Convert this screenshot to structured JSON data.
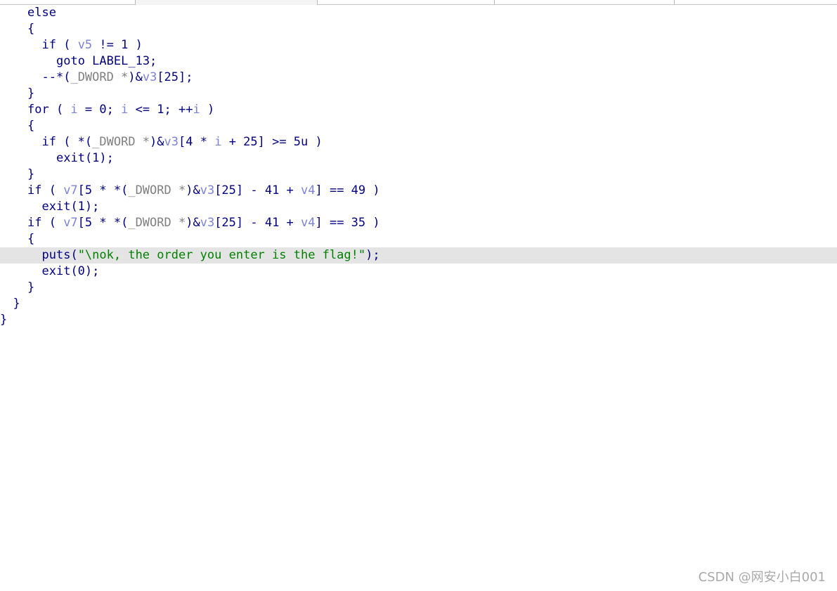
{
  "colors": {
    "keyword": "#000080",
    "variable": "#7b83d6",
    "type_cast": "#808080",
    "string": "#008000",
    "current_line_bg": "#e4e4e4",
    "watermark": "#a9a9a9"
  },
  "code": {
    "lines": [
      {
        "indent": 4,
        "tokens": [
          {
            "t": "else",
            "k": "kw"
          }
        ]
      },
      {
        "indent": 4,
        "tokens": [
          {
            "t": "{",
            "k": "pn"
          }
        ]
      },
      {
        "indent": 6,
        "tokens": [
          {
            "t": "if ( ",
            "k": "kw"
          },
          {
            "t": "v5",
            "k": "var"
          },
          {
            "t": " != 1 )",
            "k": "pn"
          }
        ]
      },
      {
        "indent": 8,
        "tokens": [
          {
            "t": "goto LABEL_13;",
            "k": "kw"
          }
        ]
      },
      {
        "indent": 6,
        "tokens": [
          {
            "t": "--*(",
            "k": "pn"
          },
          {
            "t": "_DWORD *",
            "k": "ty"
          },
          {
            "t": ")&",
            "k": "pn"
          },
          {
            "t": "v3",
            "k": "var"
          },
          {
            "t": "[25];",
            "k": "pn"
          }
        ]
      },
      {
        "indent": 4,
        "tokens": [
          {
            "t": "}",
            "k": "pn"
          }
        ]
      },
      {
        "indent": 4,
        "tokens": [
          {
            "t": "for ( ",
            "k": "kw"
          },
          {
            "t": "i",
            "k": "var"
          },
          {
            "t": " = 0; ",
            "k": "pn"
          },
          {
            "t": "i",
            "k": "var"
          },
          {
            "t": " <= 1; ++",
            "k": "pn"
          },
          {
            "t": "i",
            "k": "var"
          },
          {
            "t": " )",
            "k": "pn"
          }
        ]
      },
      {
        "indent": 4,
        "tokens": [
          {
            "t": "{",
            "k": "pn"
          }
        ]
      },
      {
        "indent": 6,
        "tokens": [
          {
            "t": "if ( *(",
            "k": "kw"
          },
          {
            "t": "_DWORD *",
            "k": "ty"
          },
          {
            "t": ")&",
            "k": "pn"
          },
          {
            "t": "v3",
            "k": "var"
          },
          {
            "t": "[4 * ",
            "k": "pn"
          },
          {
            "t": "i",
            "k": "var"
          },
          {
            "t": " + 25] >= 5u )",
            "k": "pn"
          }
        ]
      },
      {
        "indent": 8,
        "tokens": [
          {
            "t": "exit(1);",
            "k": "kw"
          }
        ]
      },
      {
        "indent": 4,
        "tokens": [
          {
            "t": "}",
            "k": "pn"
          }
        ]
      },
      {
        "indent": 4,
        "tokens": [
          {
            "t": "if ( ",
            "k": "kw"
          },
          {
            "t": "v7",
            "k": "var"
          },
          {
            "t": "[5 * *(",
            "k": "pn"
          },
          {
            "t": "_DWORD *",
            "k": "ty"
          },
          {
            "t": ")&",
            "k": "pn"
          },
          {
            "t": "v3",
            "k": "var"
          },
          {
            "t": "[25] - 41 + ",
            "k": "pn"
          },
          {
            "t": "v4",
            "k": "var"
          },
          {
            "t": "] == 49 )",
            "k": "pn"
          }
        ]
      },
      {
        "indent": 6,
        "tokens": [
          {
            "t": "exit(1);",
            "k": "kw"
          }
        ]
      },
      {
        "indent": 4,
        "tokens": [
          {
            "t": "if ( ",
            "k": "kw"
          },
          {
            "t": "v7",
            "k": "var"
          },
          {
            "t": "[5 * *(",
            "k": "pn"
          },
          {
            "t": "_DWORD *",
            "k": "ty"
          },
          {
            "t": ")&",
            "k": "pn"
          },
          {
            "t": "v3",
            "k": "var"
          },
          {
            "t": "[25] - 41 + ",
            "k": "pn"
          },
          {
            "t": "v4",
            "k": "var"
          },
          {
            "t": "] == 35 )",
            "k": "pn"
          }
        ]
      },
      {
        "indent": 4,
        "tokens": [
          {
            "t": "{",
            "k": "pn"
          }
        ]
      },
      {
        "indent": 6,
        "highlighted": true,
        "tokens": [
          {
            "t": "puts(",
            "k": "kw"
          },
          {
            "t": "\"\\nok, the order you enter is the flag!\"",
            "k": "str"
          },
          {
            "t": ");",
            "k": "pn"
          }
        ]
      },
      {
        "indent": 6,
        "tokens": [
          {
            "t": "exit(0);",
            "k": "kw"
          }
        ]
      },
      {
        "indent": 4,
        "tokens": [
          {
            "t": "}",
            "k": "pn"
          }
        ]
      },
      {
        "indent": 2,
        "tokens": [
          {
            "t": "}",
            "k": "pn"
          }
        ]
      },
      {
        "indent": 0,
        "tokens": [
          {
            "t": "}",
            "k": "pn"
          }
        ]
      }
    ]
  },
  "watermark": {
    "text": "CSDN @网安小白001"
  }
}
